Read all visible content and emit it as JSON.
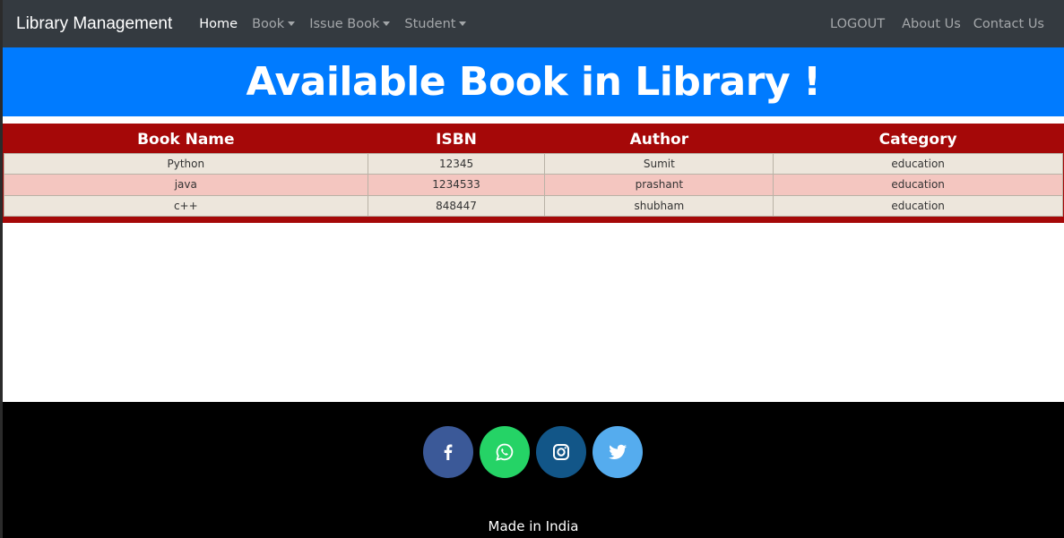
{
  "navbar": {
    "brand": "Library Management",
    "links": [
      {
        "label": "Home",
        "active": true,
        "dropdown": false
      },
      {
        "label": "Book",
        "active": false,
        "dropdown": true
      },
      {
        "label": "Issue Book",
        "active": false,
        "dropdown": true
      },
      {
        "label": "Student",
        "active": false,
        "dropdown": true
      }
    ],
    "right_links": [
      "LOGOUT",
      "About Us",
      "Contact Us"
    ]
  },
  "banner": {
    "title": "Available Book in Library !"
  },
  "table": {
    "headers": [
      "Book Name",
      "ISBN",
      "Author",
      "Category"
    ],
    "rows": [
      [
        "Python",
        "12345",
        "Sumit",
        "education"
      ],
      [
        "java",
        "1234533",
        "prashant",
        "education"
      ],
      [
        "c++",
        "848447",
        "shubham",
        "education"
      ]
    ]
  },
  "footer": {
    "socials": [
      {
        "name": "facebook-icon",
        "color": "#3b5998"
      },
      {
        "name": "whatsapp-icon",
        "color": "#25d366"
      },
      {
        "name": "instagram-icon",
        "color": "#125688"
      },
      {
        "name": "twitter-icon",
        "color": "#55acee"
      }
    ],
    "made_in": "Made in India"
  },
  "colors": {
    "navbar_bg": "#343a40",
    "banner_bg": "#007bff",
    "table_header_bg": "#a50808",
    "row_odd_bg": "#ede6dc",
    "row_even_bg": "#f4c6c0",
    "footer_bg": "#000000"
  }
}
